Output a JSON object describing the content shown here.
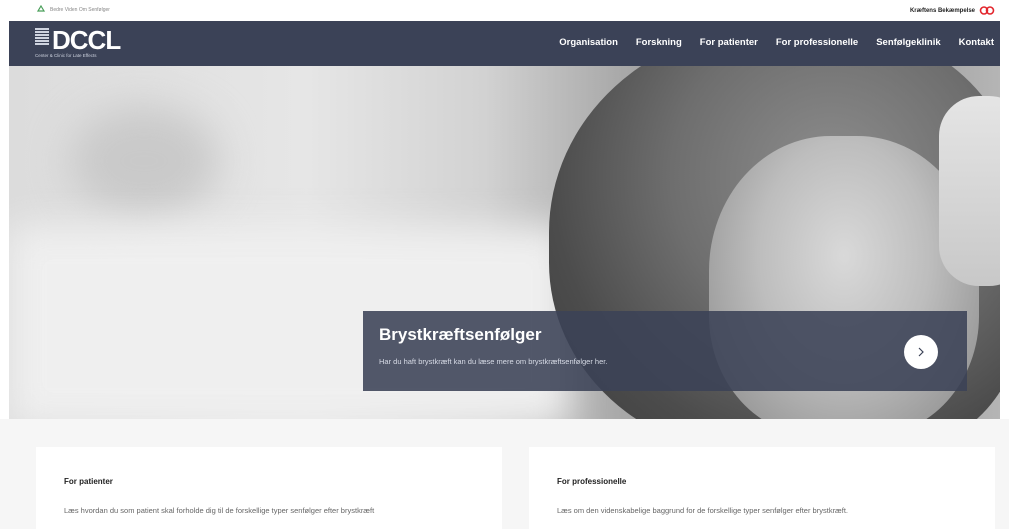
{
  "topbar": {
    "left_text": "Bedre Viden Om Senfølger",
    "right_text": "Kræftens Bekæmpelse"
  },
  "brand": {
    "name": "DCCL",
    "tagline": "Center & Clinic for Late Effects"
  },
  "nav": {
    "items": [
      {
        "label": "Organisation"
      },
      {
        "label": "Forskning"
      },
      {
        "label": "For patienter"
      },
      {
        "label": "For professionelle"
      },
      {
        "label": "Senfølgeklinik"
      },
      {
        "label": "Kontakt"
      }
    ]
  },
  "hero": {
    "title": "Brystkræftsenfølger",
    "subtitle": "Har du haft brystkræft kan du læse mere om brystkræftsenfølger her.",
    "next_icon": "chevron-right-icon"
  },
  "cards": [
    {
      "title": "For patienter",
      "text": "Læs hvordan du som patient skal forholde dig til de forskellige typer senfølger efter brystkræft"
    },
    {
      "title": "For professionelle",
      "text": "Læs om den videnskabelige baggrund for de forskellige typer senfølger efter brystkræft."
    }
  ],
  "colors": {
    "nav_background": "#3b4257",
    "accent_logo_red": "#e3262d"
  }
}
